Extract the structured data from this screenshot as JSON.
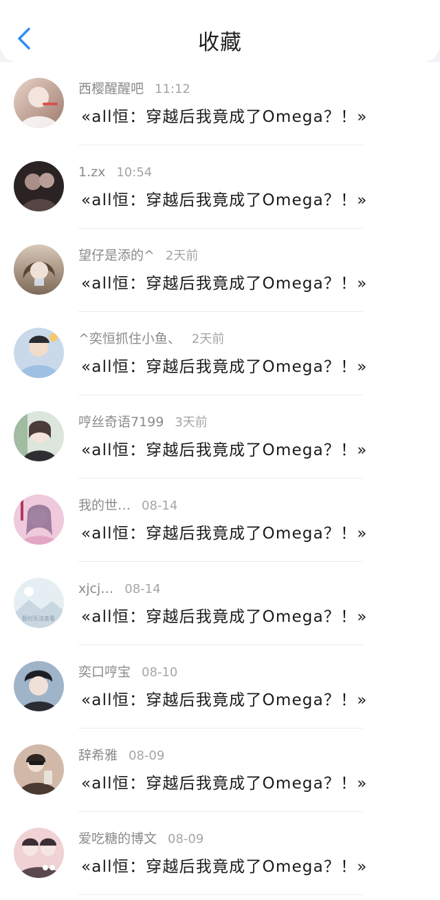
{
  "header": {
    "title": "收藏",
    "back_icon": "chevron-left-icon",
    "accent_color": "#2f8df5"
  },
  "items": [
    {
      "user": "西樱醒醒吧",
      "time": "11:12",
      "content": "«all恒：穿越后我竟成了Omega？！»",
      "avatar_colors": [
        "#e8d3c7",
        "#9f7b6f"
      ]
    },
    {
      "user": "1.zx",
      "time": "10:54",
      "content": "«all恒：穿越后我竟成了Omega？！»",
      "avatar_colors": [
        "#2b2323",
        "#8f7d7a"
      ]
    },
    {
      "user": "望仔是添的^",
      "time": "2天前",
      "content": "«all恒：穿越后我竟成了Omega？！»",
      "avatar_colors": [
        "#c9b7a6",
        "#7f6a58"
      ]
    },
    {
      "user": "^奕恒抓住小鱼、",
      "time": "2天前",
      "content": "«all恒：穿越后我竟成了Omega？！»",
      "avatar_colors": [
        "#9fc0e3",
        "#3e5068"
      ]
    },
    {
      "user": "哼丝奇语7199",
      "time": "3天前",
      "content": "«all恒：穿越后我竟成了Omega？！»",
      "avatar_colors": [
        "#dce6dc",
        "#5d7a5f"
      ]
    },
    {
      "user": "我的世…",
      "time": "08-14",
      "content": "«all恒：穿越后我竟成了Omega？！»",
      "avatar_colors": [
        "#efc9dc",
        "#a3647f"
      ]
    },
    {
      "user": "xjcj…",
      "time": "08-14",
      "content": "«all恒：穿越后我竟成了Omega？！»",
      "avatar_colors": [
        "#e5eef3",
        "#b9cad4"
      ],
      "avatar_caption": "暂时无法查看"
    },
    {
      "user": "奕口哼宝",
      "time": "08-10",
      "content": "«all恒：穿越后我竟成了Omega？！»",
      "avatar_colors": [
        "#9fb4c8",
        "#2b2c33"
      ]
    },
    {
      "user": "辞希雅",
      "time": "08-09",
      "content": "«all恒：穿越后我竟成了Omega？！»",
      "avatar_colors": [
        "#d2b8a8",
        "#4a3a31"
      ]
    },
    {
      "user": "爱吃糖的博文",
      "time": "08-09",
      "content": "«all恒：穿越后我竟成了Omega？！»",
      "avatar_colors": [
        "#f0d2d4",
        "#5a4850"
      ]
    }
  ]
}
